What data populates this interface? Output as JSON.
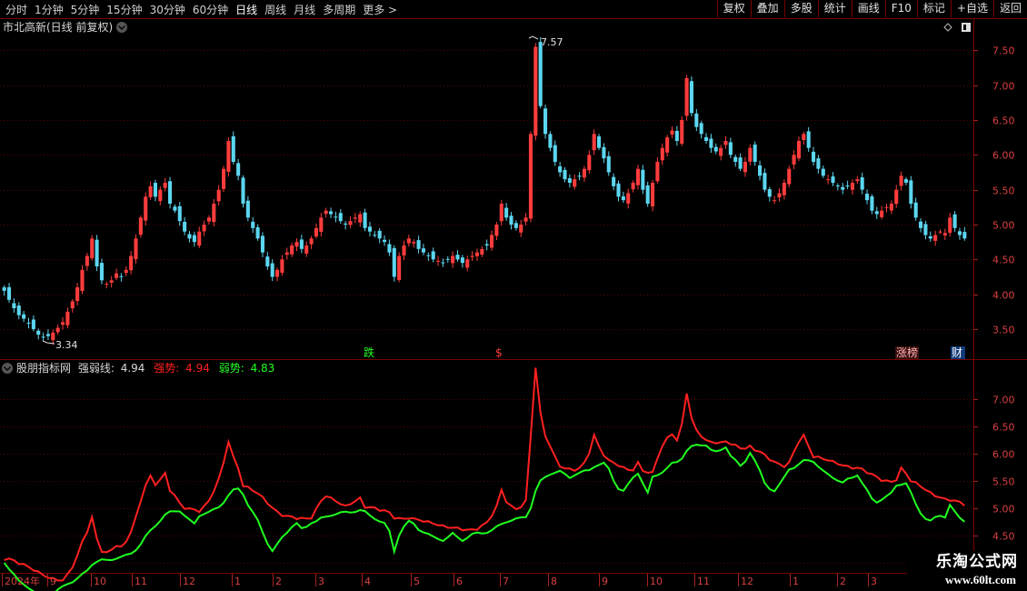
{
  "toolbar": {
    "periods": [
      "分时",
      "1分钟",
      "5分钟",
      "15分钟",
      "30分钟",
      "60分钟",
      "日线",
      "周线",
      "月线",
      "多周期",
      "更多 >"
    ],
    "active_period": "日线",
    "actions": [
      "复权",
      "叠加",
      "多股",
      "统计",
      "画线",
      "F10",
      "标记",
      "+自选",
      "返回"
    ]
  },
  "price_panel": {
    "title": "市北高新(日线 前复权)",
    "high_label": "7.57",
    "low_label": "3.34",
    "markers": [
      "跌",
      "$",
      "涨榜",
      "财"
    ]
  },
  "indicator_panel": {
    "name": "股朋指标网",
    "weak_strong_label": "强弱线:",
    "weak_strong_value": "4.94",
    "strong_label": "强势:",
    "strong_value": "4.94",
    "weak_label": "弱势:",
    "weak_value": "4.83"
  },
  "x_axis": [
    "2024年",
    "9",
    "10",
    "11",
    "12",
    "1",
    "2",
    "3",
    "4",
    "5",
    "6",
    "7",
    "8",
    "9",
    "10",
    "11",
    "12",
    "1",
    "2",
    "3"
  ],
  "watermark": {
    "line1": "乐淘公式网",
    "line2": "www.60lt.com"
  },
  "colors": {
    "up": "#ff3c3c",
    "down": "#5cd6f0",
    "strong": "#ff2020",
    "weak": "#20ff20",
    "grid": "#7a0000"
  },
  "chart_data": [
    {
      "type": "candlestick",
      "title": "市北高新(日线 前复权)",
      "y_ticks": [
        3.5,
        4.0,
        4.5,
        5.0,
        5.5,
        6.0,
        6.5,
        7.0,
        7.5
      ],
      "ylim": [
        3.2,
        7.7
      ],
      "closes": [
        4.05,
        3.92,
        3.8,
        3.7,
        3.65,
        3.58,
        3.5,
        3.42,
        3.38,
        3.4,
        3.45,
        3.52,
        3.6,
        3.75,
        3.9,
        4.1,
        4.35,
        4.55,
        4.8,
        4.4,
        4.2,
        4.15,
        4.2,
        4.3,
        4.25,
        4.35,
        4.55,
        4.8,
        5.1,
        5.4,
        5.55,
        5.4,
        5.5,
        5.6,
        5.3,
        5.2,
        5.05,
        4.9,
        4.8,
        4.75,
        4.9,
        5.0,
        5.1,
        5.3,
        5.5,
        5.8,
        6.2,
        5.9,
        5.7,
        5.3,
        5.1,
        4.95,
        4.8,
        4.6,
        4.4,
        4.25,
        4.35,
        4.5,
        4.6,
        4.7,
        4.75,
        4.65,
        4.7,
        4.8,
        4.95,
        5.1,
        5.2,
        5.15,
        5.1,
        5.05,
        5.0,
        5.05,
        5.1,
        5.15,
        4.95,
        4.9,
        4.85,
        4.8,
        4.75,
        4.6,
        4.25,
        4.55,
        4.7,
        4.8,
        4.75,
        4.65,
        4.6,
        4.55,
        4.5,
        4.48,
        4.45,
        4.5,
        4.55,
        4.5,
        4.45,
        4.5,
        4.55,
        4.6,
        4.65,
        4.7,
        4.85,
        5.0,
        5.3,
        5.1,
        5.0,
        4.95,
        5.0,
        5.1,
        6.3,
        7.55,
        6.7,
        6.3,
        6.1,
        5.9,
        5.75,
        5.65,
        5.6,
        5.65,
        5.7,
        5.8,
        6.0,
        6.3,
        6.1,
        5.95,
        5.75,
        5.55,
        5.4,
        5.35,
        5.45,
        5.6,
        5.8,
        5.5,
        5.3,
        5.6,
        5.9,
        6.1,
        6.25,
        6.35,
        6.2,
        6.5,
        7.1,
        6.6,
        6.4,
        6.3,
        6.2,
        6.1,
        6.05,
        6.1,
        6.2,
        6.0,
        5.9,
        5.8,
        5.9,
        6.1,
        5.9,
        5.7,
        5.5,
        5.4,
        5.35,
        5.45,
        5.6,
        5.8,
        6.0,
        6.2,
        6.3,
        6.1,
        5.9,
        5.8,
        5.7,
        5.65,
        5.6,
        5.55,
        5.5,
        5.55,
        5.6,
        5.65,
        5.5,
        5.35,
        5.2,
        5.15,
        5.2,
        5.25,
        5.3,
        5.5,
        5.7,
        5.6,
        5.3,
        5.1,
        4.95,
        4.85,
        4.8,
        4.85,
        4.9,
        4.88,
        5.1,
        4.95,
        4.85,
        4.8
      ]
    },
    {
      "type": "line",
      "title": "股朋指标网",
      "y_ticks": [
        4.0,
        4.5,
        5.0,
        5.5,
        6.0,
        6.5,
        7.0
      ],
      "ylim": [
        3.9,
        7.4
      ],
      "series": [
        {
          "name": "强势",
          "color": "#ff2020"
        },
        {
          "name": "弱势",
          "color": "#20ff20"
        }
      ]
    }
  ]
}
